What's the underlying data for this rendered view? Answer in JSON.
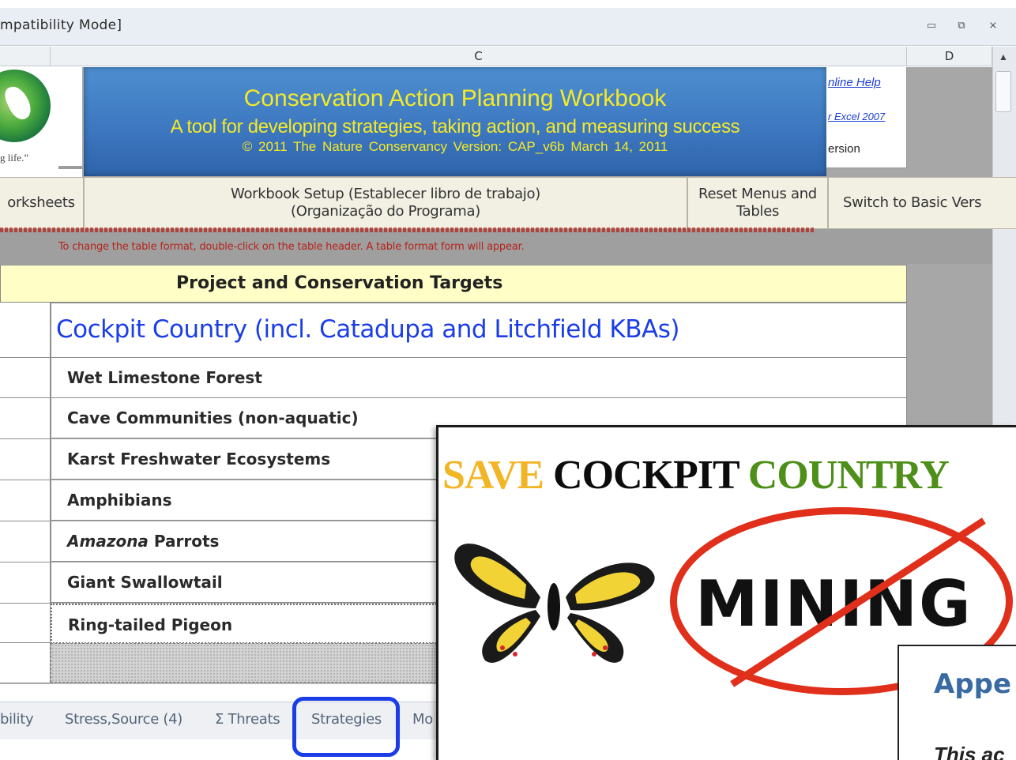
{
  "window": {
    "title": "mpatibility Mode]",
    "controls": [
      "minimize-icon",
      "restore-icon",
      "close-icon"
    ]
  },
  "columns": {
    "c": "C",
    "d": "D"
  },
  "logo": {
    "tagline": "g life.ˮ"
  },
  "banner": {
    "title": "Conservation Action Planning Workbook",
    "subtitle": "A tool for developing strategies, taking action, and measuring success",
    "copyright": "© 2011  The Nature Conservancy      Version: CAP_v6b      March 14, 2011"
  },
  "links": {
    "online_help": "nline Help",
    "excel2007": "r Excel 2007",
    "version": "ersion"
  },
  "menu": {
    "worksheets": "orksheets",
    "setup_line1": "Workbook Setup    (Establecer libro de trabajo)",
    "setup_line2": "(Organização  do Programa)",
    "reset_line1": "Reset Menus and",
    "reset_line2": "Tables",
    "switch": "Switch to Basic Vers"
  },
  "notes": {
    "line1": "To change the table format, double-click on the table header.  A table format form will appear."
  },
  "table": {
    "header": "Project and Conservation Targets",
    "project": "Cockpit Country (incl. Catadupa and Litchfield KBAs)",
    "targets": [
      "Wet Limestone Forest",
      "Cave Communities (non-aquatic)",
      "Karst Freshwater Ecosystems",
      "Amphibians",
      "Amazona  Parrots",
      "Giant Swallowtail",
      "Ring-tailed Pigeon"
    ]
  },
  "sheet_tabs": [
    "bility",
    "Stress,Source (4)",
    "Σ Threats",
    "Strategies",
    "Mo"
  ],
  "poster": {
    "save": "SAVE",
    "cockpit": "COCKPIT",
    "country": "COUNTRY",
    "mining": "MINING",
    "append": "Appe",
    "append_sub": "This ac"
  },
  "colors": {
    "banner_blue": "#3c76bf",
    "banner_text": "#f4e928",
    "project_blue": "#1a3de8",
    "header_yellow": "#fefec6",
    "note_red": "#b5241b",
    "highlight_blue": "#1a3de8",
    "no_red": "#e02f1a",
    "country_green": "#4d8f18",
    "save_gold": "#f2b526"
  }
}
